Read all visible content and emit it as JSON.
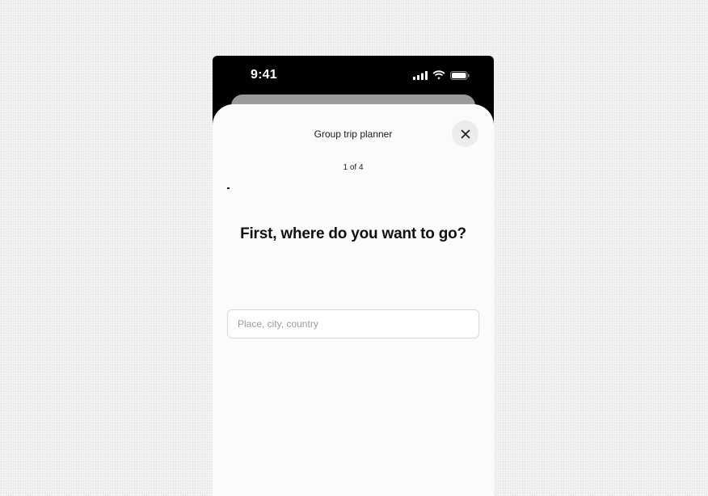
{
  "status_bar": {
    "time": "9:41"
  },
  "sheet": {
    "title": "Group trip planner",
    "step_label": "1 of 4",
    "progress": 0.01,
    "question": "First, where do you want to go?",
    "destination_input": {
      "value": "",
      "placeholder": "Place, city, country"
    }
  },
  "icons": {
    "signal": "cellular-signal-icon",
    "wifi": "wifi-icon",
    "battery": "battery-icon",
    "close": "close-icon"
  }
}
